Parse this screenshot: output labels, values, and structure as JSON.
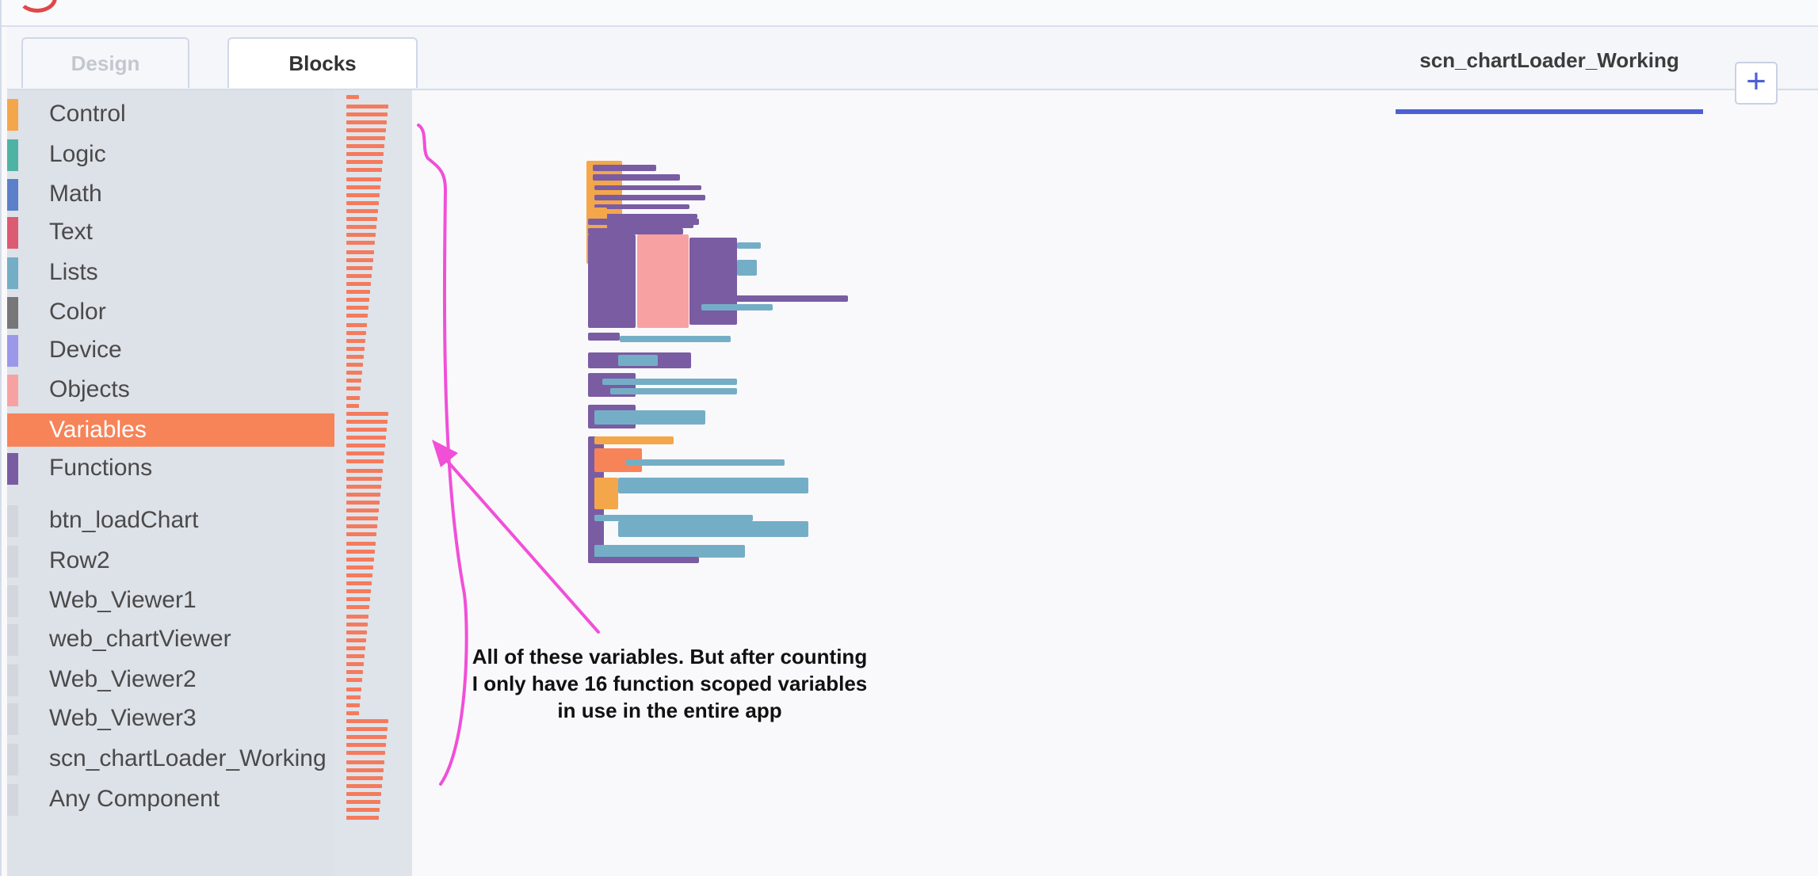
{
  "header": {
    "tabs": [
      {
        "label": "Design",
        "active": false
      },
      {
        "label": "Blocks",
        "active": true
      }
    ],
    "screen_tab": "scn_chartLoader_Working",
    "add_button": "+"
  },
  "drawer": {
    "builtin_categories": [
      {
        "label": "Control",
        "color": "#f4a64a"
      },
      {
        "label": "Logic",
        "color": "#4fb3a4"
      },
      {
        "label": "Math",
        "color": "#5b80c9"
      },
      {
        "label": "Text",
        "color": "#dd5a73"
      },
      {
        "label": "Lists",
        "color": "#74aec6"
      },
      {
        "label": "Color",
        "color": "#777777"
      },
      {
        "label": "Device",
        "color": "#9b98e9"
      },
      {
        "label": "Objects",
        "color": "#f8a1a3"
      },
      {
        "label": "Variables",
        "color": "#f78358",
        "selected": true
      },
      {
        "label": "Functions",
        "color": "#7a5ca3"
      }
    ],
    "components": [
      {
        "label": "btn_loadChart"
      },
      {
        "label": "Row2"
      },
      {
        "label": "Web_Viewer1"
      },
      {
        "label": "web_chartViewer"
      },
      {
        "label": "Web_Viewer2"
      },
      {
        "label": "Web_Viewer3"
      },
      {
        "label": "scn_chartLoader_Working"
      },
      {
        "label": "Any Component"
      }
    ],
    "selected_accent": "#f78358"
  },
  "annotation": {
    "text": "All of these variables. But after counting I only have 16 function scoped variables in use in the entire app",
    "stroke_color": "#f14fd8"
  }
}
